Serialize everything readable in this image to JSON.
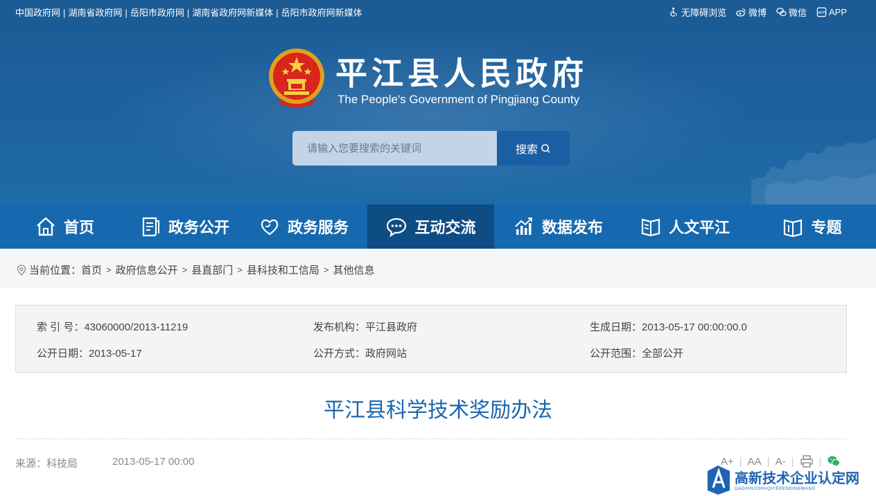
{
  "topbar": {
    "links": [
      "中国政府网",
      "湖南省政府网",
      "岳阳市政府网",
      "湖南省政府网新媒体",
      "岳阳市政府网新媒体"
    ],
    "separator": "|",
    "tools": [
      {
        "icon": "accessibility-icon",
        "label": "无障碍浏览"
      },
      {
        "icon": "weibo-icon",
        "label": "微博"
      },
      {
        "icon": "wechat-icon",
        "label": "微信"
      },
      {
        "icon": "app-icon",
        "label": "APP"
      }
    ]
  },
  "header": {
    "title": "平江县人民政府",
    "subtitle": "The People's Government of Pingjiang County",
    "emblem_icon": "national-emblem-icon"
  },
  "search": {
    "placeholder": "请输入您要搜索的关键词",
    "button_label": "搜索"
  },
  "nav": {
    "items": [
      {
        "label": "首页",
        "icon": "home-icon",
        "active": false
      },
      {
        "label": "政务公开",
        "icon": "document-icon",
        "active": false
      },
      {
        "label": "政务服务",
        "icon": "heart-hand-icon",
        "active": false
      },
      {
        "label": "互动交流",
        "icon": "chat-icon",
        "active": true
      },
      {
        "label": "数据发布",
        "icon": "chart-icon",
        "active": false
      },
      {
        "label": "人文平江",
        "icon": "book-icon",
        "active": false
      },
      {
        "label": "专题",
        "icon": "topic-book-icon",
        "active": false
      }
    ]
  },
  "breadcrumb": {
    "prefix": "当前位置：",
    "items": [
      "首页",
      "政府信息公开",
      "县直部门",
      "县科技和工信局",
      "其他信息"
    ],
    "separator": ">"
  },
  "meta": {
    "index_no": "索 引 号：43060000/2013-11219",
    "publisher": "发布机构：平江县政府",
    "created": "生成日期：2013-05-17 00:00:00.0",
    "public_date": "公开日期：2013-05-17",
    "public_method": "公开方式：政府网站",
    "public_scope": "公开范围：全部公开"
  },
  "article": {
    "title": "平江县科学技术奖励办法",
    "source": "来源：科技局",
    "date": "2013-05-17 00:00"
  },
  "tools": {
    "font_large": "A+",
    "font_normal": "AA",
    "font_small": "A-",
    "separator": "|"
  },
  "watermark": {
    "cn": "高新技术企业认定网",
    "en": "GAOXINJISHUQIYERENDINGWANG"
  },
  "colors": {
    "banner": "#1d62a0",
    "nav": "#1769af",
    "nav_active": "#0e4d84",
    "title": "#1a66b0"
  }
}
